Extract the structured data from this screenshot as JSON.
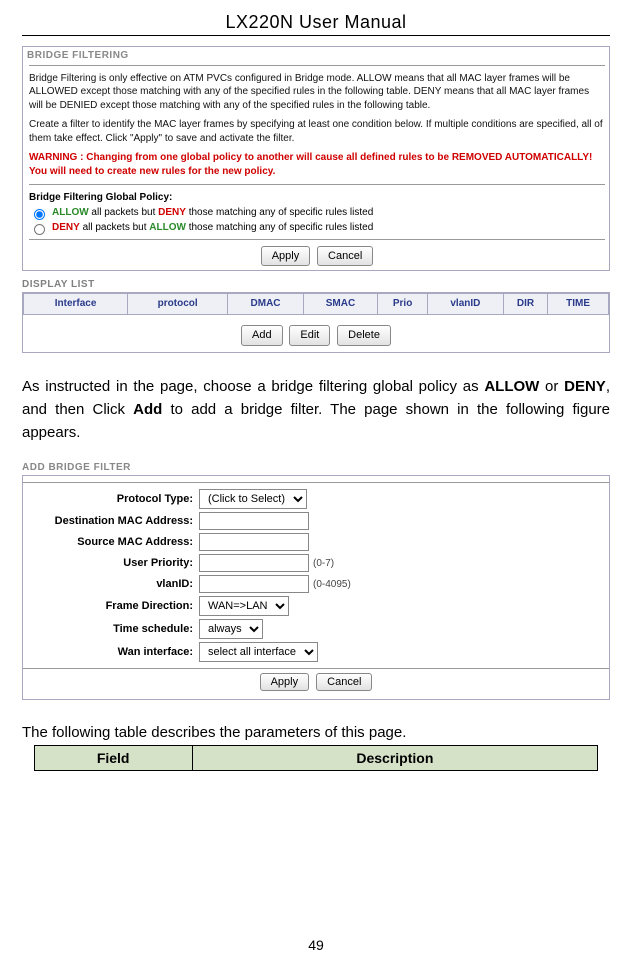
{
  "doc_title": "LX220N User Manual",
  "panel1": {
    "heading": "BRIDGE FILTERING",
    "p1": "Bridge Filtering is only effective on ATM PVCs configured in Bridge mode. ALLOW means that all MAC layer frames will be ALLOWED except those matching with any of the specified rules in the following table. DENY means that all MAC layer frames will be DENIED except those matching with any of the specified rules in the following table.",
    "p2": "Create a filter to identify the MAC layer frames by specifying at least one condition below. If multiple conditions are specified, all of them take effect. Click \"Apply\" to save and activate the filter.",
    "warning": "WARNING : Changing from one global policy to another will cause all defined rules to be REMOVED AUTOMATICALLY! You will need to create new rules for the new policy.",
    "policy_head": "Bridge Filtering Global Policy:",
    "allow_word": "ALLOW",
    "deny_word": "DENY",
    "policy_allow_tail": " all packets but ",
    "policy_deny_tail": " those matching any of specific rules listed",
    "apply": "Apply",
    "cancel": "Cancel"
  },
  "display": {
    "title": "DISPLAY LIST",
    "cols": [
      "Interface",
      "protocol",
      "DMAC",
      "SMAC",
      "Prio",
      "vlanID",
      "DIR",
      "TIME"
    ],
    "add": "Add",
    "edit": "Edit",
    "del": "Delete"
  },
  "body": {
    "before_allow": "As instructed in the page, choose a bridge filtering global policy as ",
    "allow": "ALLOW",
    "mid": " or ",
    "deny": "DENY",
    "after_deny_before_add": ", and then Click ",
    "add": "Add",
    "after_add": " to add a bridge filter. The page shown in the following figure appears."
  },
  "form": {
    "heading": "ADD BRIDGE FILTER",
    "labels": {
      "ptype": "Protocol Type:",
      "dmac": "Destination MAC Address:",
      "smac": "Source MAC Address:",
      "prio": "User Priority:",
      "vlan": "vlanID:",
      "dir": "Frame Direction:",
      "time": "Time schedule:",
      "wan": "Wan interface:"
    },
    "values": {
      "ptype": "(Click to Select)",
      "dmac": "",
      "smac": "",
      "prio": "",
      "prio_hint": "(0-7)",
      "vlan": "",
      "vlan_hint": "(0-4095)",
      "dir": "WAN=>LAN",
      "time": "always",
      "wan": "select all interface"
    },
    "apply": "Apply",
    "cancel": "Cancel"
  },
  "desc_intro": "The following table describes the parameters of this page.",
  "table": {
    "field": "Field",
    "description": "Description"
  },
  "page_number": "49"
}
